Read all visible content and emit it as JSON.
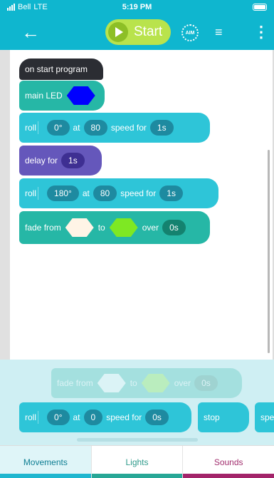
{
  "status": {
    "carrier": "Bell",
    "network": "LTE",
    "time": "5:19 PM"
  },
  "toolbar": {
    "start_label": "Start",
    "aim_label": "AIM"
  },
  "program": {
    "start_block": "on start program",
    "main_led": {
      "label": "main LED",
      "color": "#0000ff"
    },
    "roll1": {
      "label": "roll",
      "heading": "0°",
      "at": "at",
      "speed": "80",
      "speed_for": "speed for",
      "duration": "1s"
    },
    "delay": {
      "label": "delay for",
      "duration": "1s"
    },
    "roll2": {
      "label": "roll",
      "heading": "180°",
      "at": "at",
      "speed": "80",
      "speed_for": "speed for",
      "duration": "1s"
    },
    "fade": {
      "label": "fade from",
      "from_color": "#fff4e6",
      "to": "to",
      "to_color": "#7ee823",
      "over": "over",
      "duration": "0s"
    }
  },
  "tray": {
    "ghost_fade": {
      "label": "fade from",
      "to": "to",
      "over": "over",
      "duration": "0s"
    },
    "roll": {
      "label": "roll",
      "heading": "0°",
      "at": "at",
      "speed": "0",
      "speed_for": "speed for",
      "duration": "0s"
    },
    "stop": {
      "label": "stop"
    },
    "partial": {
      "label": "spe"
    }
  },
  "tabs": [
    {
      "label": "Movements",
      "active": true
    },
    {
      "label": "Lights",
      "active": false
    },
    {
      "label": "Sounds",
      "active": false
    }
  ]
}
